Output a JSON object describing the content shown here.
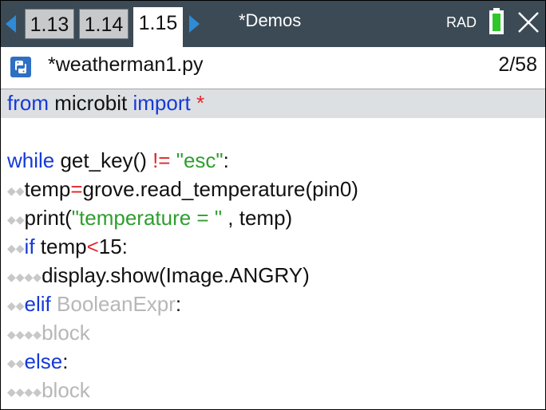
{
  "tabs": [
    {
      "label": "1.13"
    },
    {
      "label": "1.14"
    },
    {
      "label": "1.15"
    }
  ],
  "document_title": "*Demos",
  "angle_mode": "RAD",
  "file": {
    "name": "*weatherman1.py",
    "position": "2/58"
  },
  "code": {
    "l1": {
      "kw1": "from",
      "t1": " microbit ",
      "kw2": "import",
      "op": " *"
    },
    "l3": {
      "kw": "while",
      "t1": " get_key() ",
      "op": "!=",
      "t2": " ",
      "str": "\"esc\"",
      "t3": ":"
    },
    "l4": {
      "indent": "◆◆",
      "t1": "temp",
      "op": "=",
      "t2": "grove.read_temperature(pin0)"
    },
    "l5": {
      "indent": "◆◆",
      "t1": "print(",
      "str": "\"temperature = \"",
      "t2": " , temp)"
    },
    "l6": {
      "indent": "◆◆",
      "kw": "if",
      "t1": " temp",
      "op": "<",
      "t2": "15:"
    },
    "l7": {
      "indent": "◆◆◆◆",
      "t1": "display.show(Image.ANGRY)"
    },
    "l8": {
      "indent": "◆◆",
      "kw": "elif",
      "ph": " BooleanExpr",
      "t1": ":"
    },
    "l9": {
      "indent": "◆◆◆◆",
      "ph": "block"
    },
    "l10": {
      "indent": "◆◆",
      "kw": "else",
      "t1": ":"
    },
    "l11": {
      "indent": "◆◆◆◆",
      "ph": "block"
    }
  },
  "colors": {
    "topbar": "#3c4a55",
    "keyword": "#1539d8",
    "string": "#2f9e2f",
    "operator": "#e0262b",
    "placeholder": "#b7b7b7",
    "battery": "#2ec62a"
  }
}
